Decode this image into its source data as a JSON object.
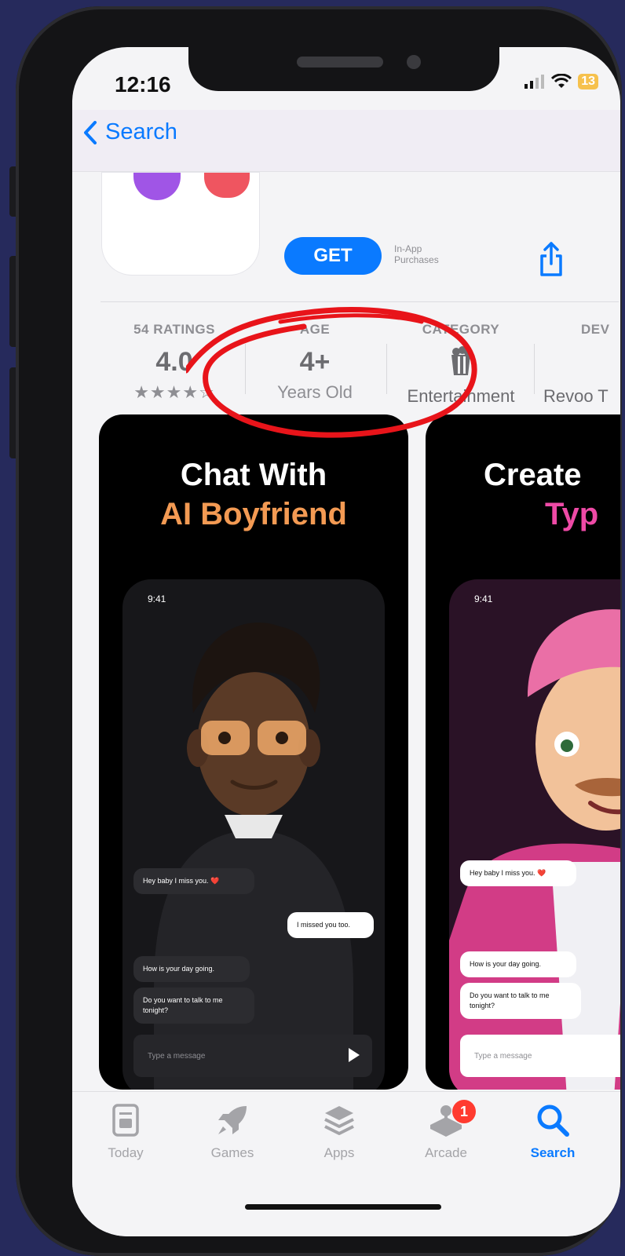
{
  "status_bar": {
    "time": "12:16",
    "battery": "13"
  },
  "nav": {
    "back_label": "Search"
  },
  "app": {
    "get_label": "GET",
    "in_app_purchases": "In-App Purchases"
  },
  "stats": {
    "ratings": {
      "label": "54 RATINGS",
      "value": "4.0",
      "stars": "★★★★☆",
      "rating": 4.0
    },
    "age": {
      "label": "AGE",
      "value": "4+",
      "sub": "Years Old"
    },
    "category": {
      "label": "CATEGORY",
      "sub": "Entertainment",
      "icon": "entertainment-icon"
    },
    "developer": {
      "label": "DEV",
      "sub": "Revoo T"
    }
  },
  "annotation": {
    "color": "#e8141a",
    "shape": "hand-drawn circle around age"
  },
  "screenshots": [
    {
      "title_line1": "Chat With",
      "title_line2": "AI Boyfriend",
      "accent_color": "#f39a53",
      "phone_time": "9:41",
      "messages": [
        "Hey baby I miss you. ❤️",
        "I missed you too.",
        "How is your day going.",
        "Do you want to talk to me tonight?"
      ],
      "input_placeholder": "Type a message"
    },
    {
      "title_line1": "Create",
      "title_line2": "Typ",
      "accent_color": "#ee4aa6",
      "phone_time": "9:41",
      "messages": [
        "Hey baby I miss you. ❤️",
        "How is your day going.",
        "Do you want to talk to me tonight?"
      ],
      "input_placeholder": "Type a message"
    }
  ],
  "tabbar": {
    "tabs": [
      {
        "label": "Today",
        "icon": "today-icon"
      },
      {
        "label": "Games",
        "icon": "rocket-icon"
      },
      {
        "label": "Apps",
        "icon": "apps-stack-icon"
      },
      {
        "label": "Arcade",
        "icon": "joystick-icon",
        "badge": "1"
      },
      {
        "label": "Search",
        "icon": "search-icon",
        "active": true
      }
    ]
  },
  "colors": {
    "accent": "#0a7aff",
    "badge": "#ff3b30",
    "background": "#262a5c"
  }
}
